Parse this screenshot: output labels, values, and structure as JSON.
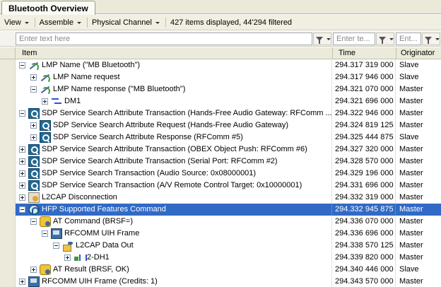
{
  "tab": {
    "title": "Bluetooth Overview"
  },
  "toolbar": {
    "view_label": "View",
    "assemble_label": "Assemble",
    "channel_label": "Physical Channel",
    "status_text": "427 items displayed, 44'294 filtered"
  },
  "filters": {
    "item_placeholder": "Enter text here",
    "time_placeholder": "Enter te...",
    "orig_placeholder": "Ent..."
  },
  "columns": {
    "item": "Item",
    "time": "Time",
    "originator": "Originator"
  },
  "rows": [
    {
      "level": 0,
      "expander": "minus",
      "icon": "lmp",
      "label": "LMP Name (\"MB Bluetooth\")",
      "time": "294.317 319 000",
      "orig": "Slave"
    },
    {
      "level": 1,
      "expander": "plus",
      "icon": "lmp",
      "label": "LMP Name request",
      "time": "294.317 946 000",
      "orig": "Slave"
    },
    {
      "level": 1,
      "expander": "minus",
      "icon": "lmp",
      "label": "LMP Name response (\"MB Bluetooth\")",
      "time": "294.321 070 000",
      "orig": "Master"
    },
    {
      "level": 2,
      "expander": "plus",
      "icon": "arrow",
      "label": "DM1",
      "time": "294.321 696 000",
      "orig": "Master"
    },
    {
      "level": 0,
      "expander": "minus",
      "icon": "sdp",
      "label": "SDP Service Search Attribute Transaction (Hands-Free Audio Gateway: RFComm ...",
      "time": "294.322 946 000",
      "orig": "Master"
    },
    {
      "level": 1,
      "expander": "plus",
      "icon": "sdp",
      "label": "SDP Service Search Attribute Request (Hands-Free Audio Gateway)",
      "time": "294.324 819 125",
      "orig": "Master"
    },
    {
      "level": 1,
      "expander": "plus",
      "icon": "sdp",
      "label": "SDP Service Search Attribute Response (RFComm #5)",
      "time": "294.325 444 875",
      "orig": "Slave"
    },
    {
      "level": 0,
      "expander": "plus",
      "icon": "sdp",
      "label": "SDP Service Search Attribute Transaction (OBEX Object Push: RFComm #6)",
      "time": "294.327 320 000",
      "orig": "Master"
    },
    {
      "level": 0,
      "expander": "plus",
      "icon": "sdp",
      "label": "SDP Service Search Attribute Transaction (Serial Port: RFComm #2)",
      "time": "294.328 570 000",
      "orig": "Master"
    },
    {
      "level": 0,
      "expander": "plus",
      "icon": "sdp",
      "label": "SDP Service Search Transaction (Audio Source: 0x08000001)",
      "time": "294.329 196 000",
      "orig": "Master"
    },
    {
      "level": 0,
      "expander": "plus",
      "icon": "sdp",
      "label": "SDP Service Search Transaction (A/V Remote Control Target: 0x10000001)",
      "time": "294.331 696 000",
      "orig": "Master"
    },
    {
      "level": 0,
      "expander": "plus",
      "icon": "l2cap",
      "label": "L2CAP Disconnection",
      "time": "294.332 319 000",
      "orig": "Master"
    },
    {
      "level": 0,
      "expander": "minus",
      "icon": "hfp",
      "label": "HFP Supported Features Command",
      "time": "294.332 945 875",
      "orig": "Master",
      "selected": true
    },
    {
      "level": 1,
      "expander": "minus",
      "icon": "at",
      "label": "AT Command (BRSF=)",
      "time": "294.336 070 000",
      "orig": "Master"
    },
    {
      "level": 2,
      "expander": "minus",
      "icon": "rfc",
      "label": "RFCOMM UIH Frame",
      "time": "294.336 696 000",
      "orig": "Master"
    },
    {
      "level": 3,
      "expander": "minus",
      "icon": "l2data",
      "label": "L2CAP Data Out",
      "time": "294.338 570 125",
      "orig": "Master"
    },
    {
      "level": 4,
      "expander": "plus",
      "icon": "lock",
      "label": "2-DH1",
      "time": "294.339 820 000",
      "orig": "Master"
    },
    {
      "level": 1,
      "expander": "plus",
      "icon": "at",
      "label": "AT Result (BRSF, OK)",
      "time": "294.340 446 000",
      "orig": "Slave"
    },
    {
      "level": 0,
      "expander": "plus",
      "icon": "rfc",
      "label": "RFCOMM UIH Frame (Credits: 1)",
      "time": "294.343 570 000",
      "orig": "Master"
    }
  ]
}
